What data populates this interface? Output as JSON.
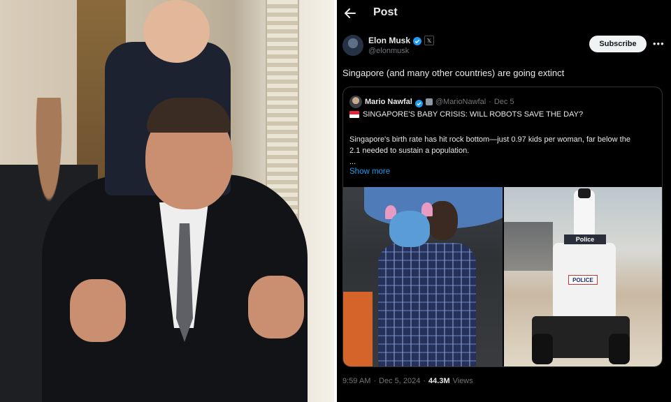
{
  "header": {
    "title": "Post"
  },
  "author": {
    "display_name": "Elon Musk",
    "handle": "@elonmusk",
    "verified": true,
    "subscribe_label": "Subscribe"
  },
  "post": {
    "text": "Singapore (and many other countries) are going extinct",
    "time": "9:59 AM",
    "date": "Dec 5, 2024",
    "separator": "·",
    "views_count": "44.3M",
    "views_label": "Views"
  },
  "quoted": {
    "display_name": "Mario Nawfal",
    "handle": "@MarioNawfal",
    "date": "Dec 5",
    "separator": "·",
    "headline": "SINGAPORE'S BABY CRISIS: WILL ROBOTS SAVE THE DAY?",
    "body": "Singapore's birth rate has hit rock bottom—just 0.97 kids per woman, far below the 2.1 needed to sustain a population.",
    "ellipsis": "...",
    "show_more": "Show more",
    "robot_sign": "Police",
    "robot_label": "POLICE"
  },
  "colors": {
    "background": "#000000",
    "link": "#1d9bf0",
    "verified": "#1d9bf0",
    "muted": "#71767b"
  },
  "icons": {
    "back": "arrow-left-icon",
    "verified": "verified-badge-icon",
    "x_badge": "x-logo-icon",
    "more": "more-horizontal-icon",
    "flag": "singapore-flag-icon"
  }
}
